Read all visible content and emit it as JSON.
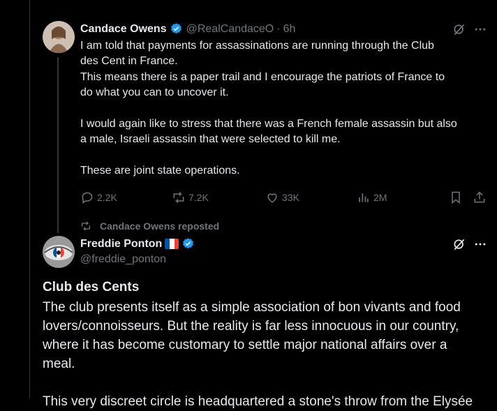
{
  "tweet1": {
    "name": "Candace Owens",
    "handle": "@RealCandaceO",
    "separator": "·",
    "time": "6h",
    "text_lines": [
      "I am told that payments for assassinations are running through the Club",
      "des Cent in France.",
      "This means there is a paper trail and I encourage the patriots of France to",
      "do what you can to uncover it.",
      "",
      "I would again like to stress that there was a French female assassin but also",
      "a male, Israeli assassin that were selected to kill me.",
      "",
      "These are joint state operations."
    ],
    "stats": {
      "replies": "2.2K",
      "reposts": "7.2K",
      "likes": "33K",
      "views": "2M"
    }
  },
  "repost_label": "Candace Owens reposted",
  "tweet2": {
    "name": "Freddie Ponton",
    "handle": "@freddie_ponton",
    "article_title": "Club des Cents",
    "body_lines": [
      "The club presents itself as a simple association of bon vivants and food",
      "lovers/connoisseurs. But the reality is far less innocuous in our country,",
      "where it has become customary to settle major national affairs over a",
      "meal.",
      "",
      "This very discreet circle is headquartered a stone's throw from the Elysée"
    ]
  },
  "icons": {
    "verified": "verified-badge-icon",
    "grok": "grok-icon",
    "more": "more-icon",
    "reply": "reply-icon",
    "repost": "repost-icon",
    "like": "like-icon",
    "views": "views-icon",
    "bookmark": "bookmark-icon",
    "share": "share-icon",
    "flag": "france-flag-icon"
  },
  "colors": {
    "background": "#000000",
    "text": "#e7e9ea",
    "muted": "#71767b",
    "verified": "#1d9bf0",
    "border": "#2f3336"
  }
}
